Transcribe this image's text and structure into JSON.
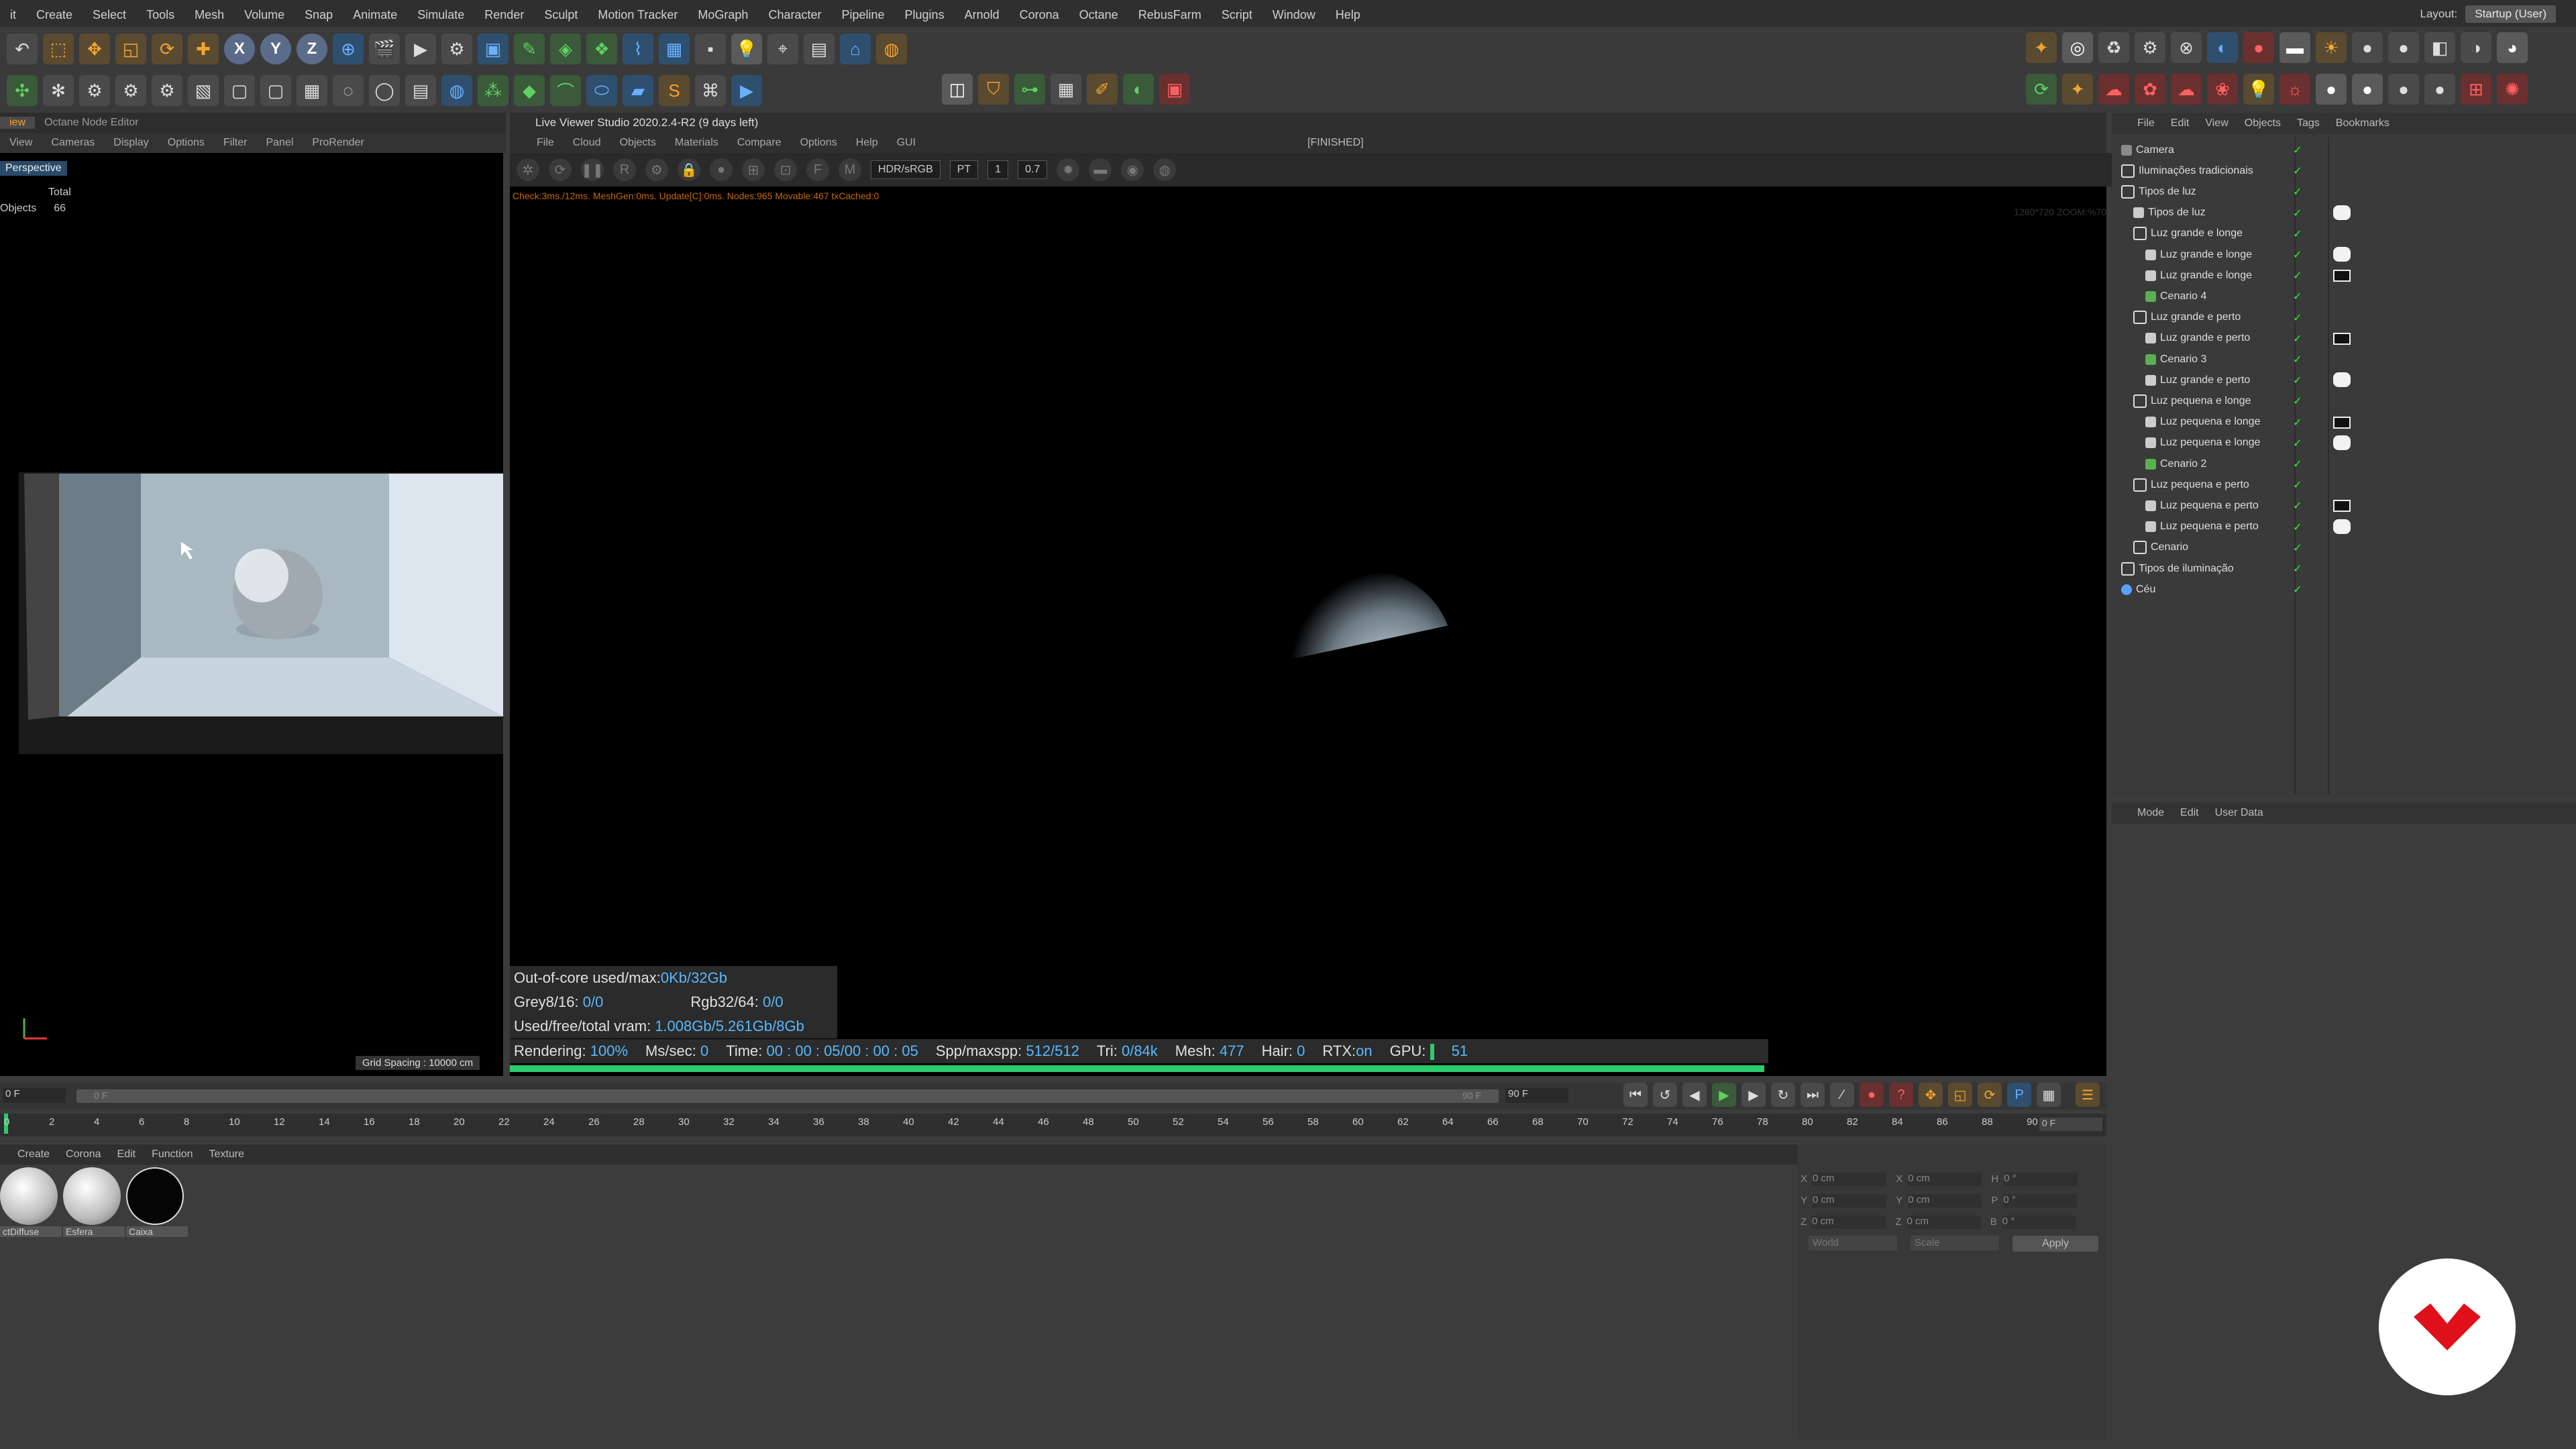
{
  "menubar": {
    "items": [
      "it",
      "Create",
      "Select",
      "Tools",
      "Mesh",
      "Volume",
      "Snap",
      "Animate",
      "Simulate",
      "Render",
      "Sculpt",
      "Motion Tracker",
      "MoGraph",
      "Character",
      "Pipeline",
      "Plugins",
      "Arnold",
      "Corona",
      "Octane",
      "RebusFarm",
      "Script",
      "Window",
      "Help"
    ],
    "layout_label": "Layout:",
    "layout_value": "Startup (User)"
  },
  "left_panel": {
    "tabs": [
      "iew",
      "Octane Node Editor"
    ],
    "menu": [
      "View",
      "Cameras",
      "Display",
      "Options",
      "Filter",
      "Panel",
      "ProRender"
    ],
    "viewport_name": "Perspective",
    "stats_header": "Total",
    "stats_label": "Objects",
    "stats_value": "66",
    "grid_spacing": "Grid Spacing : 10000 cm"
  },
  "live_viewer": {
    "title": "Live Viewer Studio 2020.2.4-R2 (9 days left)",
    "menu": [
      "File",
      "Cloud",
      "Objects",
      "Materials",
      "Compare",
      "Options",
      "Help",
      "GUI"
    ],
    "status": "[FINISHED]",
    "colorspace": "HDR/sRGB",
    "kernel": "PT",
    "field_a": "1",
    "field_b": "0.7",
    "check_line": "Check:3ms./12ms. MeshGen:0ms. Update[C]:0ms. Nodes:965 Movable:467 txCached:0",
    "zoom_text": "1280*720 ZOOM:%70",
    "hud": {
      "ooc_label": "Out-of-core used/max:",
      "ooc_value": "0Kb/32Gb",
      "grey_label": "Grey8/16:",
      "grey_value": "0/0",
      "rgb_label": "Rgb32/64:",
      "rgb_value": "0/0",
      "vram_label": "Used/free/total vram:",
      "vram_value": "1.008Gb/5.261Gb/8Gb"
    },
    "render": {
      "rendering_label": "Rendering:",
      "rendering_value": "100%",
      "ms_label": "Ms/sec:",
      "ms_value": "0",
      "time_label": "Time:",
      "time_value": "00 : 00 : 05/00 : 00 : 05",
      "spp_label": "Spp/maxspp:",
      "spp_value": "512/512",
      "tri_label": "Tri:",
      "tri_value": "0/84k",
      "mesh_label": "Mesh:",
      "mesh_value": "477",
      "hair_label": "Hair:",
      "hair_value": "0",
      "rtx_label": "RTX:",
      "rtx_value": "on",
      "gpu_label": "GPU:",
      "gpu_value": "51"
    },
    "progress": 1.0
  },
  "object_manager": {
    "menu": [
      "File",
      "Edit",
      "View",
      "Objects",
      "Tags",
      "Bookmarks"
    ],
    "rows": [
      {
        "name": "Camera",
        "icon": "camera-icon",
        "indent": 0
      },
      {
        "name": "Iluminações tradicionais",
        "icon": "null-icon",
        "indent": 0
      },
      {
        "name": "Tipos de luz",
        "icon": "null-icon",
        "indent": 0
      },
      {
        "name": "Tipos de luz",
        "icon": "text-icon",
        "indent": 1
      },
      {
        "name": "Luz grande e longe",
        "icon": "null-icon",
        "indent": 1
      },
      {
        "name": "Luz grande e longe",
        "icon": "text-icon",
        "indent": 2
      },
      {
        "name": "Luz grande e longe",
        "icon": "light-icon",
        "indent": 2
      },
      {
        "name": "Cenario 4",
        "icon": "scene-icon",
        "indent": 2
      },
      {
        "name": "Luz grande e perto",
        "icon": "null-icon",
        "indent": 1
      },
      {
        "name": "Luz grande e perto",
        "icon": "light-icon",
        "indent": 2
      },
      {
        "name": "Cenario 3",
        "icon": "scene-icon",
        "indent": 2
      },
      {
        "name": "Luz grande e perto",
        "icon": "text-icon",
        "indent": 2
      },
      {
        "name": "Luz pequena e longe",
        "icon": "null-icon",
        "indent": 1
      },
      {
        "name": "Luz pequena e longe",
        "icon": "light-icon",
        "indent": 2
      },
      {
        "name": "Luz pequena e longe",
        "icon": "text-icon",
        "indent": 2
      },
      {
        "name": "Cenario 2",
        "icon": "scene-icon",
        "indent": 2
      },
      {
        "name": "Luz pequena e perto",
        "icon": "null-icon",
        "indent": 1
      },
      {
        "name": "Luz pequena e perto",
        "icon": "light-icon",
        "indent": 2
      },
      {
        "name": "Luz pequena e perto",
        "icon": "text-icon",
        "indent": 2
      },
      {
        "name": "Cenario",
        "icon": "null-icon",
        "indent": 1
      },
      {
        "name": "Tipos de iluminação",
        "icon": "null-icon",
        "indent": 0
      },
      {
        "name": "Céu",
        "icon": "sky-icon",
        "indent": 0
      }
    ]
  },
  "attributes": {
    "menu": [
      "Mode",
      "Edit",
      "User Data"
    ]
  },
  "timeline": {
    "start_frame": "0 F",
    "range_start": "0 F",
    "range_end": "90 F",
    "end_frame": "90 F",
    "current_frame": "0 F",
    "ticks": [
      "0",
      "2",
      "4",
      "6",
      "8",
      "10",
      "12",
      "14",
      "16",
      "18",
      "20",
      "22",
      "24",
      "26",
      "28",
      "30",
      "32",
      "34",
      "36",
      "38",
      "40",
      "42",
      "44",
      "46",
      "48",
      "50",
      "52",
      "54",
      "56",
      "58",
      "60",
      "62",
      "64",
      "66",
      "68",
      "70",
      "72",
      "74",
      "76",
      "78",
      "80",
      "82",
      "84",
      "86",
      "88",
      "90"
    ]
  },
  "material_manager": {
    "menu": [
      "Create",
      "Corona",
      "Edit",
      "Function",
      "Texture"
    ],
    "materials": [
      {
        "label": "ctDiffuse",
        "color": "#e8e8e8"
      },
      {
        "label": "Esfera",
        "color": "#d8d8d8"
      },
      {
        "label": "Caixa",
        "color": "#050505"
      }
    ]
  },
  "coordinates": {
    "rows": [
      {
        "a": "X",
        "av": "0 cm",
        "b": "X",
        "bv": "0 cm",
        "c": "H",
        "cv": "0 °"
      },
      {
        "a": "Y",
        "av": "0 cm",
        "b": "Y",
        "bv": "0 cm",
        "c": "P",
        "cv": "0 °"
      },
      {
        "a": "Z",
        "av": "0 cm",
        "b": "Z",
        "bv": "0 cm",
        "c": "B",
        "cv": "0 °"
      }
    ],
    "mode_world": "World",
    "mode_scale": "Scale",
    "apply_label": "Apply"
  },
  "colors": {
    "accent_orange": "#f0a030",
    "hud_value_blue": "#57b8ff",
    "progress_green": "#2ccc6c",
    "logo_red": "#e0101a"
  }
}
